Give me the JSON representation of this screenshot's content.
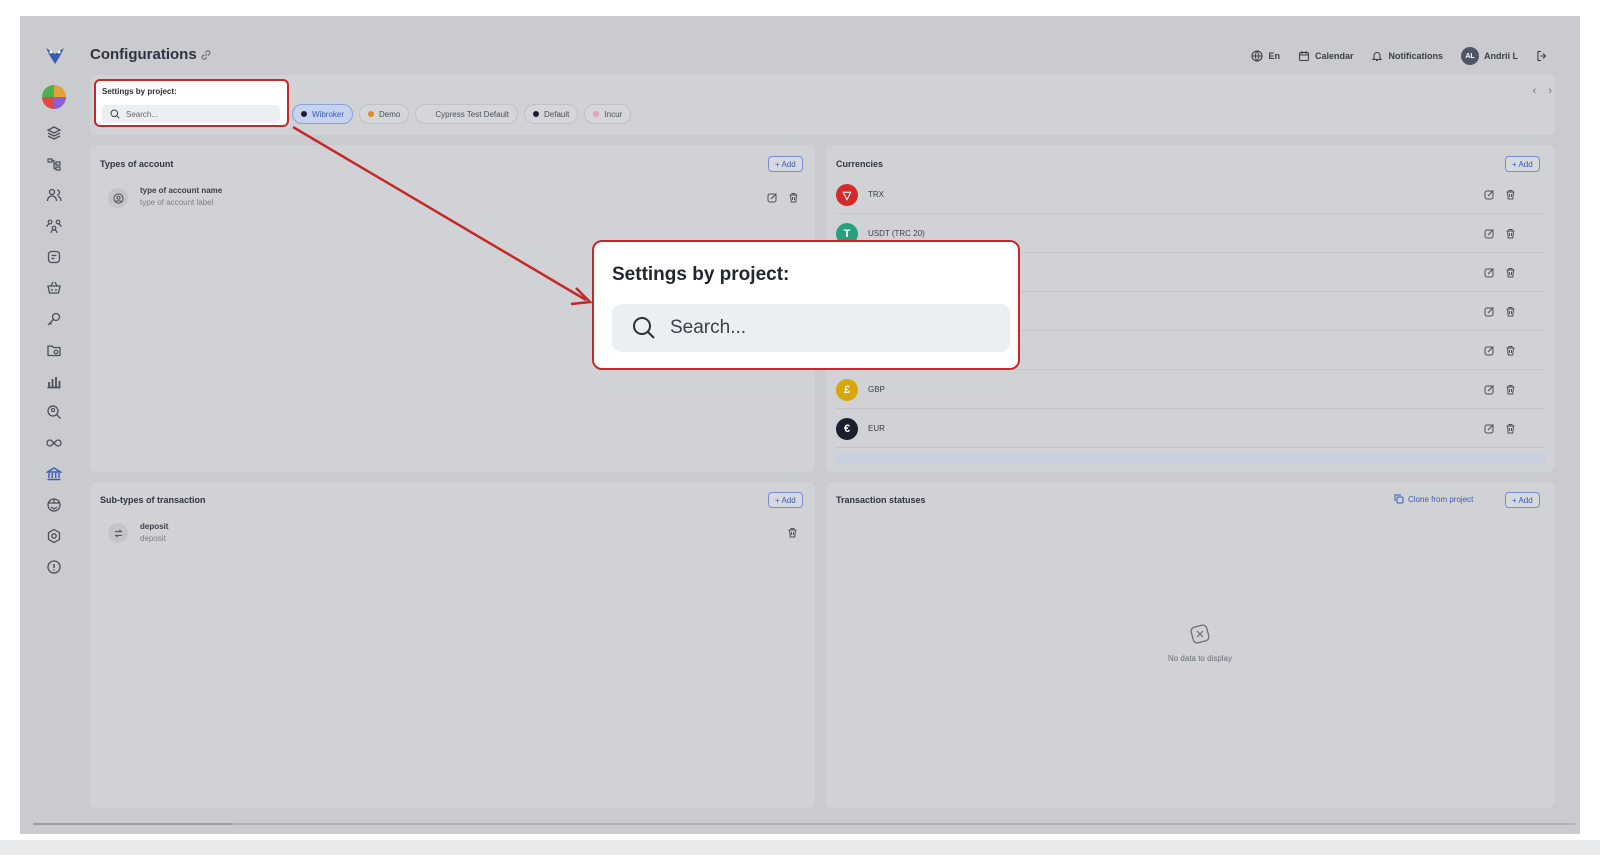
{
  "header": {
    "title": "Configurations",
    "language": "En",
    "calendar": "Calendar",
    "notifications": "Notifications",
    "user_initials": "AL",
    "user_name": "Andrii L"
  },
  "project_filter": {
    "label": "Settings by project:",
    "search_placeholder": "Search...",
    "chips": [
      {
        "label": "Wibroker",
        "dot": "#1a1f2b",
        "active": true
      },
      {
        "label": "Demo",
        "dot": "#e08a2a",
        "active": false
      },
      {
        "label": "Cypress Test Default",
        "dot": "#d6d8db",
        "active": false
      },
      {
        "label": "Default",
        "dot": "#1a1f2b",
        "active": false
      },
      {
        "label": "Incur",
        "dot": "#e8a0b8",
        "active": false
      }
    ]
  },
  "types_of_account": {
    "title": "Types of account",
    "add_label": "+ Add",
    "items": [
      {
        "name": "type of account name",
        "label": "type of account label"
      }
    ]
  },
  "currencies": {
    "title": "Currencies",
    "add_label": "+ Add",
    "items": [
      {
        "name": "TRX",
        "symbol": "▽",
        "color": "#d42a2a"
      },
      {
        "name": "USDT (TRC 20)",
        "symbol": "T",
        "color": "#26a17b"
      },
      {
        "name": "",
        "symbol": "",
        "color": "#9aa0aa"
      },
      {
        "name": "",
        "symbol": "",
        "color": "#9aa0aa"
      },
      {
        "name": "",
        "symbol": "",
        "color": "#9aa0aa"
      },
      {
        "name": "GBP",
        "symbol": "£",
        "color": "#d7a70c"
      },
      {
        "name": "EUR",
        "symbol": "€",
        "color": "#1a1f2b"
      }
    ]
  },
  "sub_types": {
    "title": "Sub-types of transaction",
    "add_label": "+ Add",
    "items": [
      {
        "name": "deposit",
        "label": "deposit"
      }
    ]
  },
  "transaction_statuses": {
    "title": "Transaction statuses",
    "clone_label": "Clone from project",
    "add_label": "+ Add",
    "empty_text": "No data to display"
  },
  "callout": {
    "label": "Settings by project:",
    "search_placeholder": "Search..."
  },
  "colors": {
    "accent": "#3a5bb5",
    "highlight": "#c62828",
    "overlay": "#c9cbcf"
  }
}
